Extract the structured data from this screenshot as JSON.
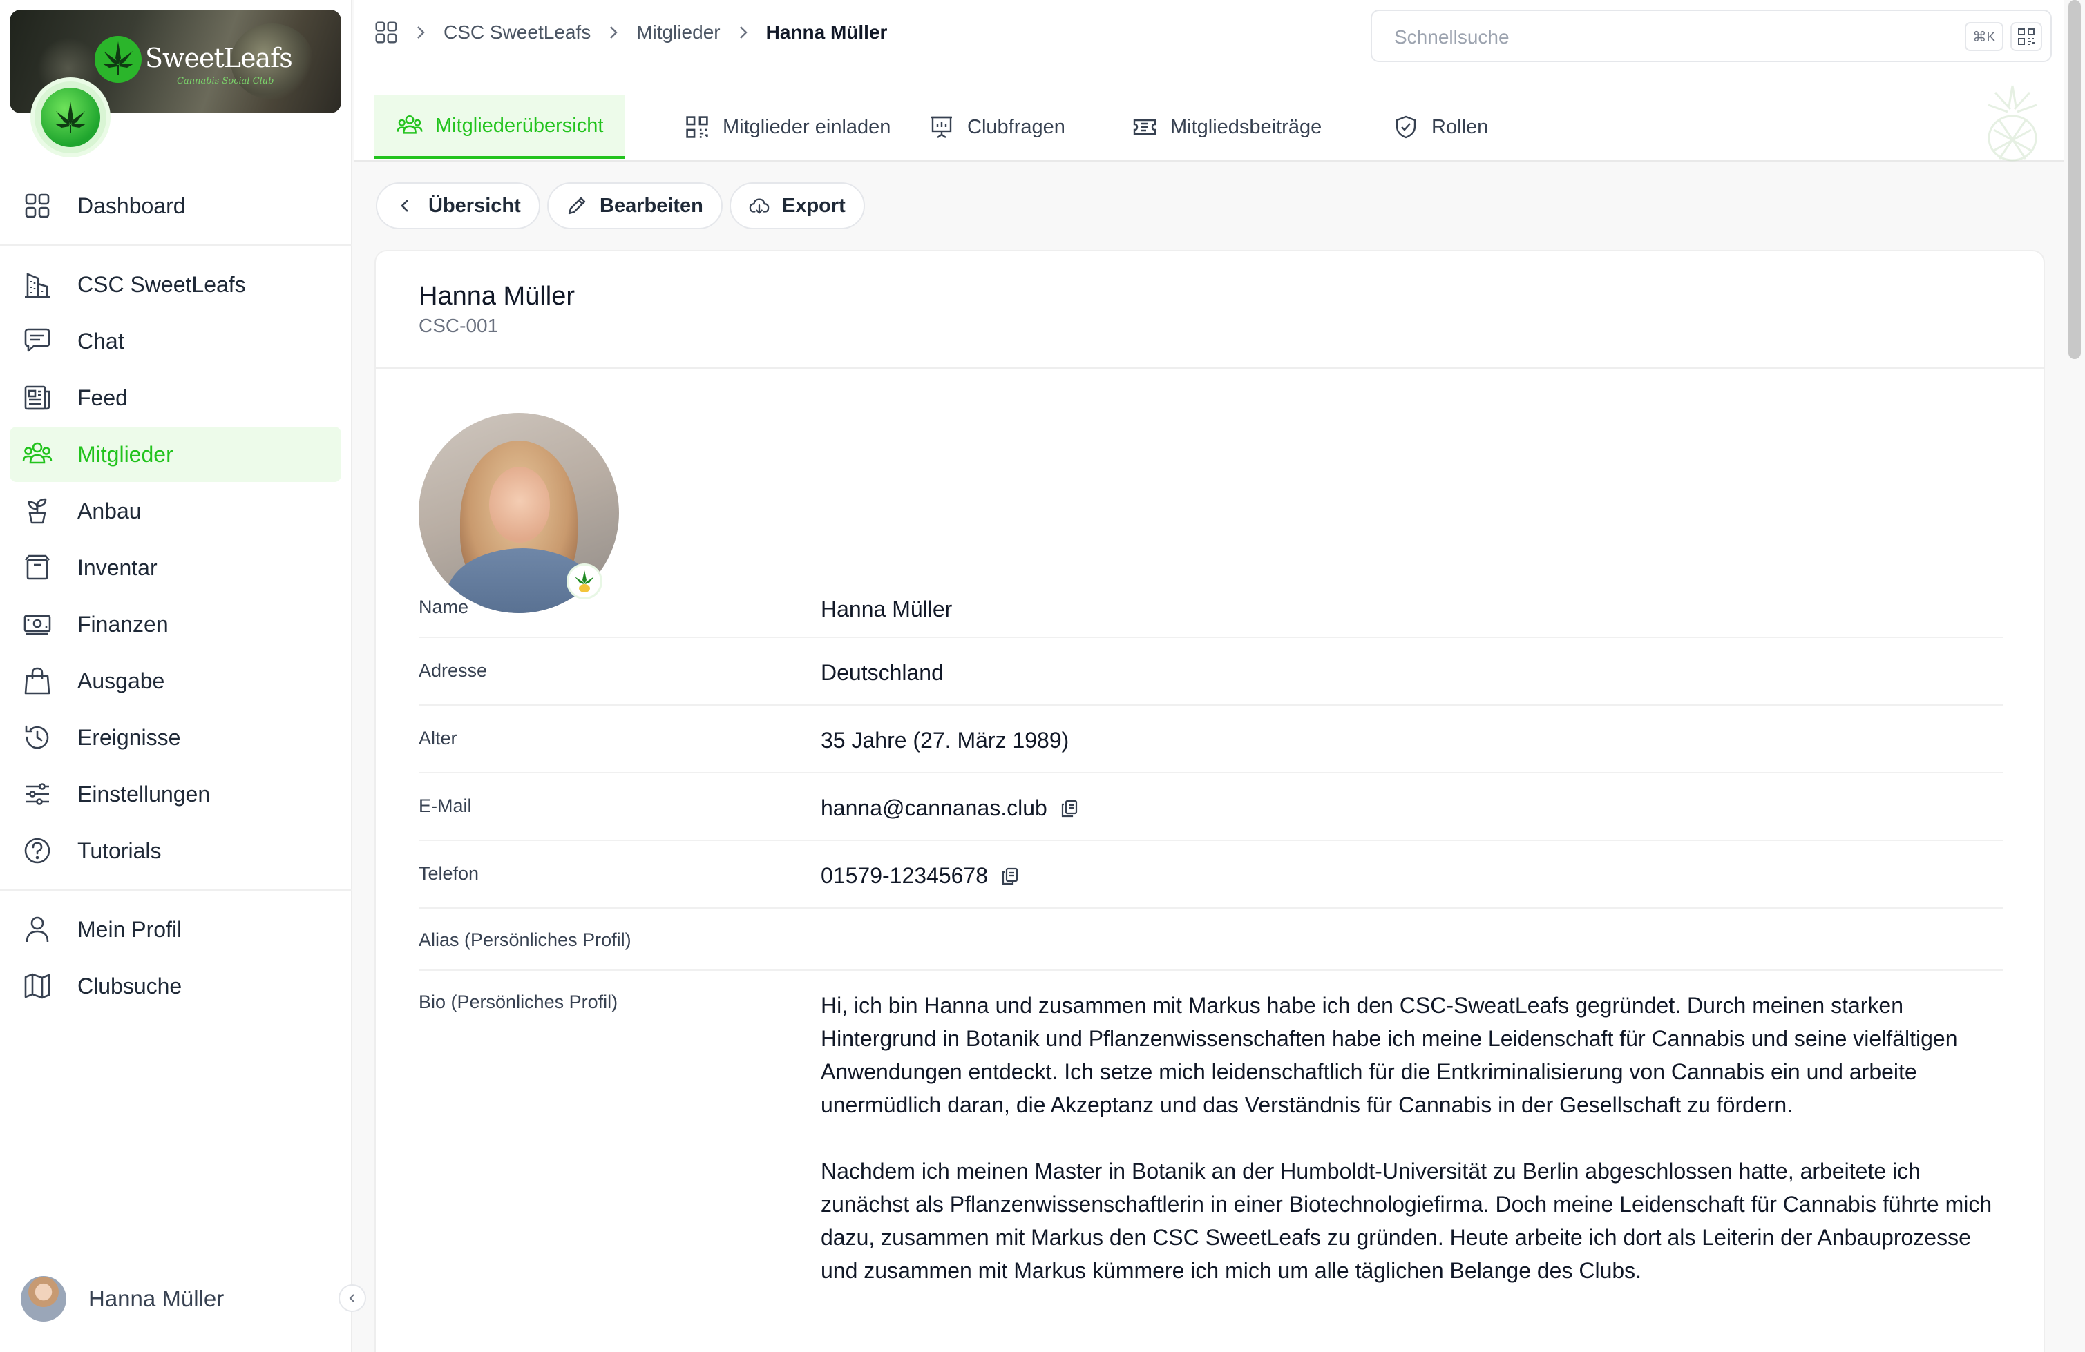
{
  "sidebar": {
    "club_brand": "SweetLeafs",
    "club_brand_sub": "Cannabis Social Club",
    "items": [
      {
        "label": "Dashboard",
        "icon": "grid-icon"
      },
      {
        "label": "CSC SweetLeafs",
        "icon": "building-icon"
      },
      {
        "label": "Chat",
        "icon": "chat-icon"
      },
      {
        "label": "Feed",
        "icon": "newspaper-icon"
      },
      {
        "label": "Mitglieder",
        "icon": "users-icon",
        "active": true
      },
      {
        "label": "Anbau",
        "icon": "plant-icon"
      },
      {
        "label": "Inventar",
        "icon": "box-icon"
      },
      {
        "label": "Finanzen",
        "icon": "money-icon"
      },
      {
        "label": "Ausgabe",
        "icon": "bag-icon"
      },
      {
        "label": "Ereignisse",
        "icon": "history-icon"
      },
      {
        "label": "Einstellungen",
        "icon": "sliders-icon"
      },
      {
        "label": "Tutorials",
        "icon": "help-icon"
      },
      {
        "label": "Mein Profil",
        "icon": "user-icon"
      },
      {
        "label": "Clubsuche",
        "icon": "map-icon"
      }
    ],
    "user_name": "Hanna Müller"
  },
  "breadcrumb": {
    "items": [
      "CSC SweetLeafs",
      "Mitglieder"
    ],
    "current": "Hanna Müller"
  },
  "search": {
    "placeholder": "Schnellsuche",
    "shortcut": "⌘K"
  },
  "tabs": [
    {
      "label": "Mitgliederübersicht",
      "icon": "users-icon",
      "active": true
    },
    {
      "label": "Mitglieder einladen",
      "icon": "qr-code-icon"
    },
    {
      "label": "Clubfragen",
      "icon": "presentation-icon"
    },
    {
      "label": "Mitgliedsbeiträge",
      "icon": "ticket-icon"
    },
    {
      "label": "Rollen",
      "icon": "shield-check-icon"
    }
  ],
  "actions": {
    "back_label": "Übersicht",
    "edit_label": "Bearbeiten",
    "export_label": "Export"
  },
  "member": {
    "name": "Hanna Müller",
    "id": "CSC-001",
    "fields": [
      {
        "label": "Name",
        "value": "Hanna Müller"
      },
      {
        "label": "Adresse",
        "value": "Deutschland"
      },
      {
        "label": "Alter",
        "value": "35 Jahre (27. März 1989)"
      },
      {
        "label": "E-Mail",
        "value": "hanna@cannanas.club",
        "copy": true
      },
      {
        "label": "Telefon",
        "value": "01579-12345678",
        "copy": true
      },
      {
        "label": "Alias (Persönliches Profil)",
        "value": ""
      }
    ],
    "bio_label": "Bio (Persönliches Profil)",
    "bio": [
      "Hi, ich bin Hanna und zusammen mit Markus habe ich den CSC-SweatLeafs gegründet.  Durch meinen starken Hintergrund in Botanik und Pflanzenwissenschaften habe ich meine Leidenschaft für Cannabis und seine vielfältigen Anwendungen entdeckt. Ich setze mich leidenschaftlich für die Entkriminalisierung von Cannabis ein und arbeite unermüdlich daran, die Akzeptanz und das Verständnis für Cannabis in der Gesellschaft zu fördern.",
      "Nachdem ich meinen Master in Botanik an der Humboldt-Universität zu Berlin abgeschlossen hatte, arbeitete ich zunächst als Pflanzenwissenschaftlerin in einer Biotechnologiefirma. Doch meine Leidenschaft für Cannabis führte mich dazu, zusammen mit Markus den CSC SweetLeafs zu gründen. Heute arbeite ich dort als Leiterin der Anbauprozesse und zusammen mit Markus kümmere ich mich um alle täglichen Belange des Clubs."
    ]
  },
  "colors": {
    "accent": "#22c31d",
    "accent_bg": "#edfbea"
  }
}
